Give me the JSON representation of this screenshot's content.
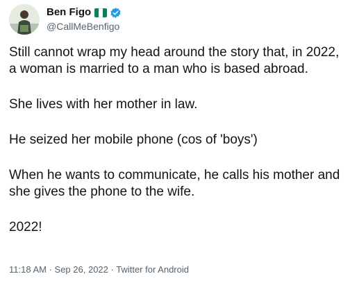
{
  "author": {
    "display_name": "Ben Figo",
    "handle": "@CallMeBenfigo",
    "flag_icon": "nigeria-flag-icon",
    "verified_icon": "verified-badge-icon",
    "colors": {
      "flag_green": "#008751",
      "flag_white": "#ffffff",
      "verified_blue": "#1d9bf0"
    }
  },
  "tweet": {
    "paragraphs": [
      "Still cannot wrap my head around the story that, in 2022, a woman is married to a man who is based abroad.",
      "She lives with her mother in law.",
      "He seized her mobile phone (cos of 'boys')",
      "When he wants to communicate, he calls his mother and she gives the phone to the wife.",
      "2022!"
    ]
  },
  "meta": {
    "time": "11:18 AM",
    "separator": " · ",
    "date": "Sep 26, 2022",
    "source": "Twitter for Android"
  }
}
